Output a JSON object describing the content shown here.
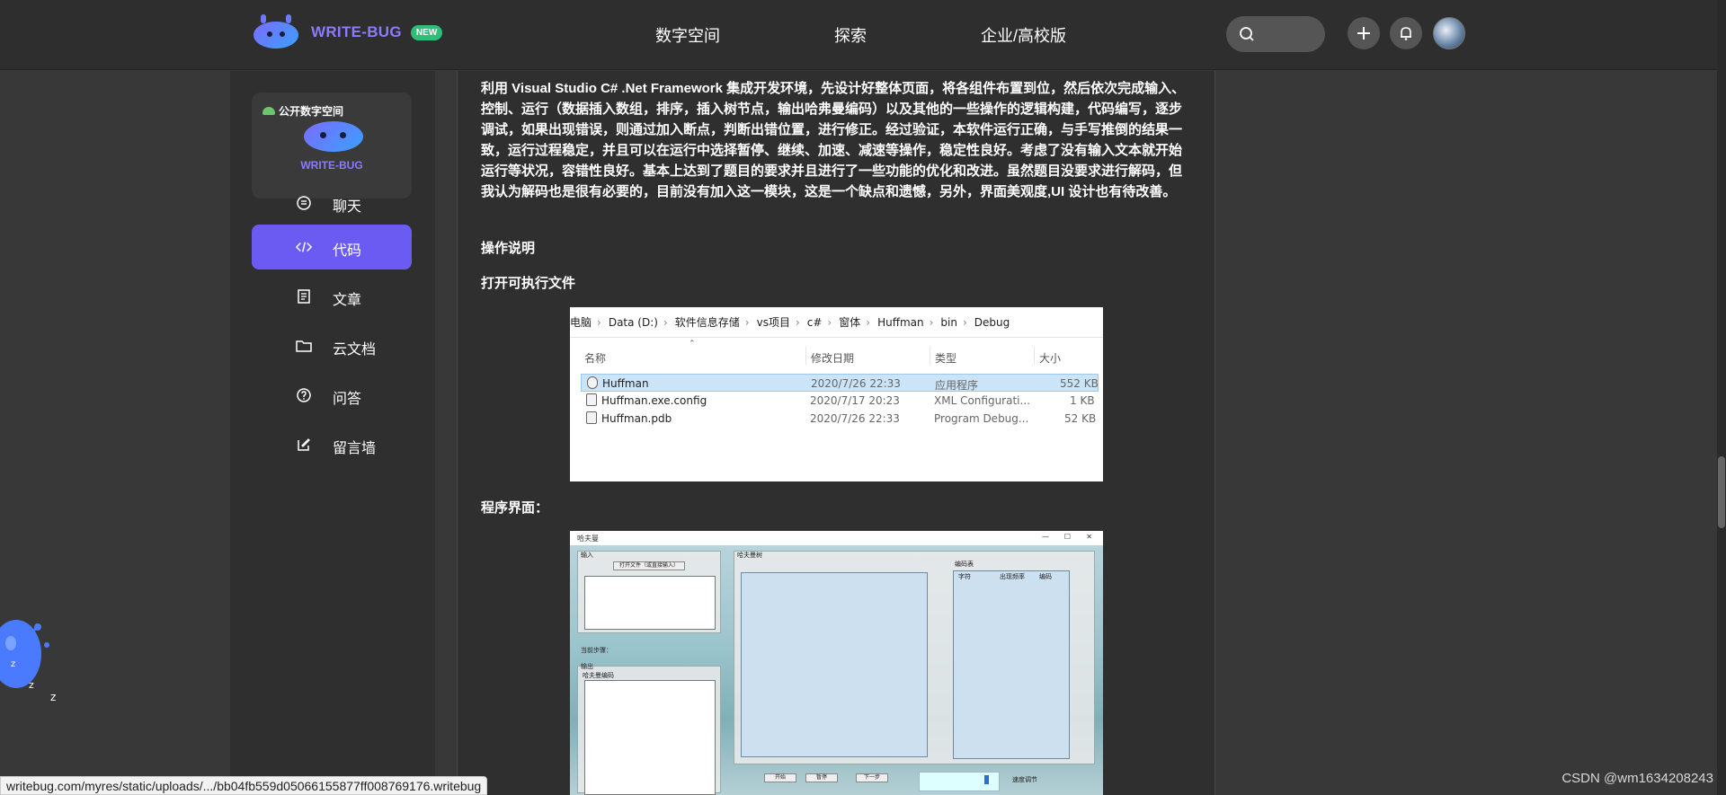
{
  "header": {
    "brand": "WRITE-BUG",
    "badge": "NEW",
    "nav": [
      "数字空间",
      "探索",
      "企业/高校版"
    ]
  },
  "sidebar": {
    "space_card_label": "公开数字空间",
    "space_card_brand": "WRITE-BUG",
    "items": [
      {
        "label": "聊天",
        "icon": "chat-icon"
      },
      {
        "label": "代码",
        "icon": "code-icon",
        "active": true
      },
      {
        "label": "文章",
        "icon": "article-icon"
      },
      {
        "label": "云文档",
        "icon": "folder-icon"
      },
      {
        "label": "问答",
        "icon": "question-icon"
      },
      {
        "label": "留言墙",
        "icon": "edit-icon"
      }
    ]
  },
  "article": {
    "paragraph": "利用 Visual Studio C# .Net Framework 集成开发环境，先设计好整体页面，将各组件布置到位，然后依次完成输入、控制、运行（数据插入数组，排序，插入树节点，输出哈弗曼编码）以及其他的一些操作的逻辑构建，代码编写，逐步调试，如果出现错误，则通过加入断点，判断出错位置，进行修正。经过验证，本软件运行正确，与手写推倒的结果一致，运行过程稳定，并且可以在运行中选择暂停、继续、加速、减速等操作，稳定性良好。考虑了没有输入文本就开始运行等状况，容错性良好。基本上达到了题目的要求并且进行了一些功能的优化和改进。虽然题目没要求进行解码，但我认为解码也是很有必要的，目前没有加入这一模块，这是一个缺点和遗憾，另外，界面美观度,UI 设计也有待改善。",
    "heading_ops": "操作说明",
    "heading_open": "打开可执行文件",
    "heading_ui": "程序界面："
  },
  "explorer": {
    "breadcrumbs": [
      "电脑",
      "Data (D:)",
      "软件信息存储",
      "vs项目",
      "c#",
      "窗体",
      "Huffman",
      "bin",
      "Debug"
    ],
    "columns": [
      "名称",
      "修改日期",
      "类型",
      "大小"
    ],
    "rows": [
      {
        "name": "Huffman",
        "date": "2020/7/26 22:33",
        "type": "应用程序",
        "size": "552 KB"
      },
      {
        "name": "Huffman.exe.config",
        "date": "2020/7/17 20:23",
        "type": "XML Configurati...",
        "size": "1 KB"
      },
      {
        "name": "Huffman.pdb",
        "date": "2020/7/26 22:33",
        "type": "Program Debug...",
        "size": "52 KB"
      }
    ]
  },
  "program": {
    "title": "哈夫曼",
    "input_label": "输入",
    "open_file_button": "打开文件（或直接输入）",
    "steps_label": "当前步骤：",
    "output_label": "输出",
    "output_sub": "哈夫曼编码",
    "tree_label": "哈夫曼树",
    "code_table_label": "编码表",
    "code_cols": [
      "字符",
      "出现频率",
      "编码"
    ],
    "buttons": [
      "开始",
      "暂停",
      "下一步"
    ],
    "speed_label": "速度调节"
  },
  "status_url": "writebug.com/myres/static/uploads/.../bb04fb559d05066155877ff008769176.writebug",
  "watermark": "CSDN @wm1634208243"
}
